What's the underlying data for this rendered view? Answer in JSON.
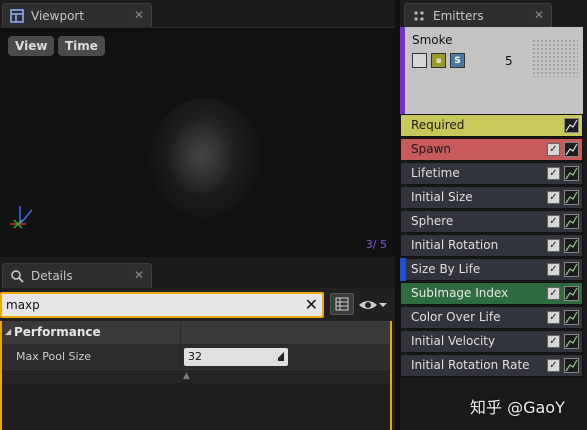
{
  "viewport": {
    "tab_label": "Viewport",
    "view_button": "View",
    "time_button": "Time",
    "particle_count": "3/  5"
  },
  "details": {
    "tab_label": "Details",
    "search_value": "maxp",
    "category_label": "Performance",
    "property_label": "Max Pool Size",
    "property_value": "32"
  },
  "emitters": {
    "tab_label": "Emitters",
    "emitter_name": "Smoke",
    "emitter_count": "5",
    "accent_color": "#7a2ad6",
    "modules": [
      {
        "label": "Required"
      },
      {
        "label": "Spawn"
      },
      {
        "label": "Lifetime"
      },
      {
        "label": "Initial Size"
      },
      {
        "label": "Sphere"
      },
      {
        "label": "Initial Rotation"
      },
      {
        "label": "Size By Life"
      },
      {
        "label": "SubImage Index"
      },
      {
        "label": "Color Over Life"
      },
      {
        "label": "Initial Velocity"
      },
      {
        "label": "Initial Rotation Rate"
      }
    ]
  },
  "watermark": "知乎 @GaoY",
  "colors": {
    "required_module": "#c9c85a",
    "spawn_module": "#c85a5a",
    "subimage_module": "#2e6b3e",
    "selection_border": "#f0a800"
  }
}
